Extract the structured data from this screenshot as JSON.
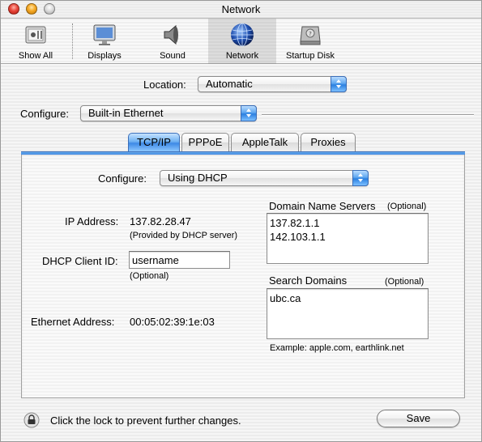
{
  "window": {
    "title": "Network"
  },
  "toolbar": {
    "items": [
      {
        "label": "Show All",
        "icon": "apple-switch-icon"
      },
      {
        "label": "Displays",
        "icon": "display-icon"
      },
      {
        "label": "Sound",
        "icon": "speaker-icon"
      },
      {
        "label": "Network",
        "icon": "globe-icon",
        "selected": true
      },
      {
        "label": "Startup Disk",
        "icon": "hard-disk-icon"
      }
    ]
  },
  "location": {
    "label": "Location:",
    "value": "Automatic"
  },
  "configure_interface": {
    "label": "Configure:",
    "value": "Built-in Ethernet"
  },
  "tabs": [
    {
      "label": "TCP/IP",
      "active": true
    },
    {
      "label": "PPPoE",
      "active": false
    },
    {
      "label": "AppleTalk",
      "active": false
    },
    {
      "label": "Proxies",
      "active": false
    }
  ],
  "tcpip": {
    "configure_label": "Configure:",
    "configure_value": "Using DHCP",
    "ip_address_label": "IP Address:",
    "ip_address_value": "137.82.28.47",
    "ip_address_note": "(Provided by DHCP server)",
    "dhcp_client_id_label": "DHCP Client ID:",
    "dhcp_client_id_value": "username",
    "dhcp_client_id_note": "(Optional)",
    "ethernet_address_label": "Ethernet Address:",
    "ethernet_address_value": "00:05:02:39:1e:03",
    "dns_label": "Domain Name Servers",
    "dns_optional": "(Optional)",
    "dns_servers": [
      "137.82.1.1",
      "142.103.1.1"
    ],
    "search_domains_label": "Search Domains",
    "search_domains_optional": "(Optional)",
    "search_domains": [
      "ubc.ca"
    ],
    "search_domains_example": "Example: apple.com, earthlink.net"
  },
  "footer": {
    "lock_text": "Click the lock to prevent further changes.",
    "save_label": "Save"
  },
  "colors": {
    "aqua_blue": "#3e8ae6",
    "tab_border": "#3b6eb8"
  }
}
